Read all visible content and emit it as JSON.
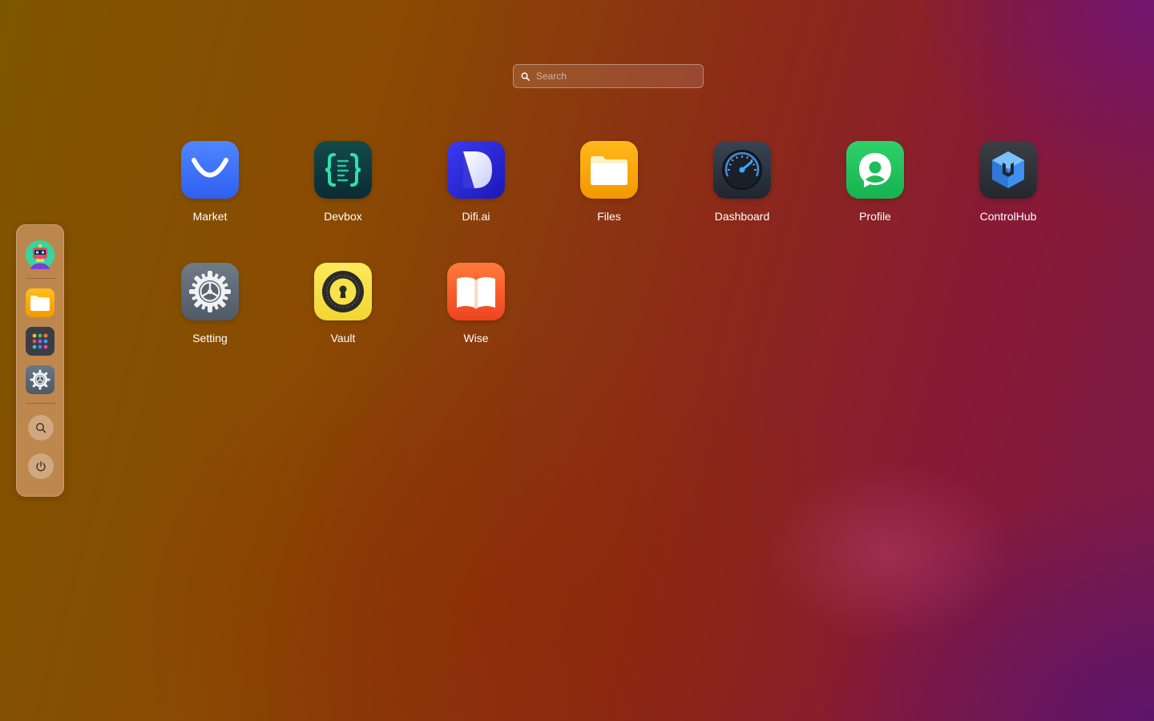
{
  "search": {
    "placeholder": "Search",
    "icon": "search-icon"
  },
  "dock": {
    "items": [
      {
        "name": "avatar",
        "icon": "robot-avatar"
      },
      {
        "name": "files",
        "icon": "folder-icon"
      },
      {
        "name": "launchpad",
        "icon": "app-grid-icon"
      },
      {
        "name": "settings",
        "icon": "gear-icon"
      },
      {
        "name": "search",
        "icon": "search-icon"
      },
      {
        "name": "power",
        "icon": "power-icon"
      }
    ]
  },
  "apps": [
    {
      "label": "Market",
      "icon": "shopping-bag-icon",
      "color": "#3b6ef7"
    },
    {
      "label": "Devbox",
      "icon": "code-braces-icon",
      "color": "#0f3b3c"
    },
    {
      "label": "Difi.ai",
      "icon": "difi-logo-icon",
      "color": "#2b2ad8"
    },
    {
      "label": "Files",
      "icon": "folder-icon",
      "color": "#f7a500"
    },
    {
      "label": "Dashboard",
      "icon": "speedometer-icon",
      "color": "#2b3440"
    },
    {
      "label": "Profile",
      "icon": "profile-pin-icon",
      "color": "#1ec45a"
    },
    {
      "label": "ControlHub",
      "icon": "cube-wrench-icon",
      "color": "#2f3238"
    },
    {
      "label": "Setting",
      "icon": "gear-icon",
      "color": "#5f6c78"
    },
    {
      "label": "Vault",
      "icon": "keyhole-icon",
      "color": "#f6e050"
    },
    {
      "label": "Wise",
      "icon": "open-book-icon",
      "color": "#f35a2b"
    }
  ]
}
